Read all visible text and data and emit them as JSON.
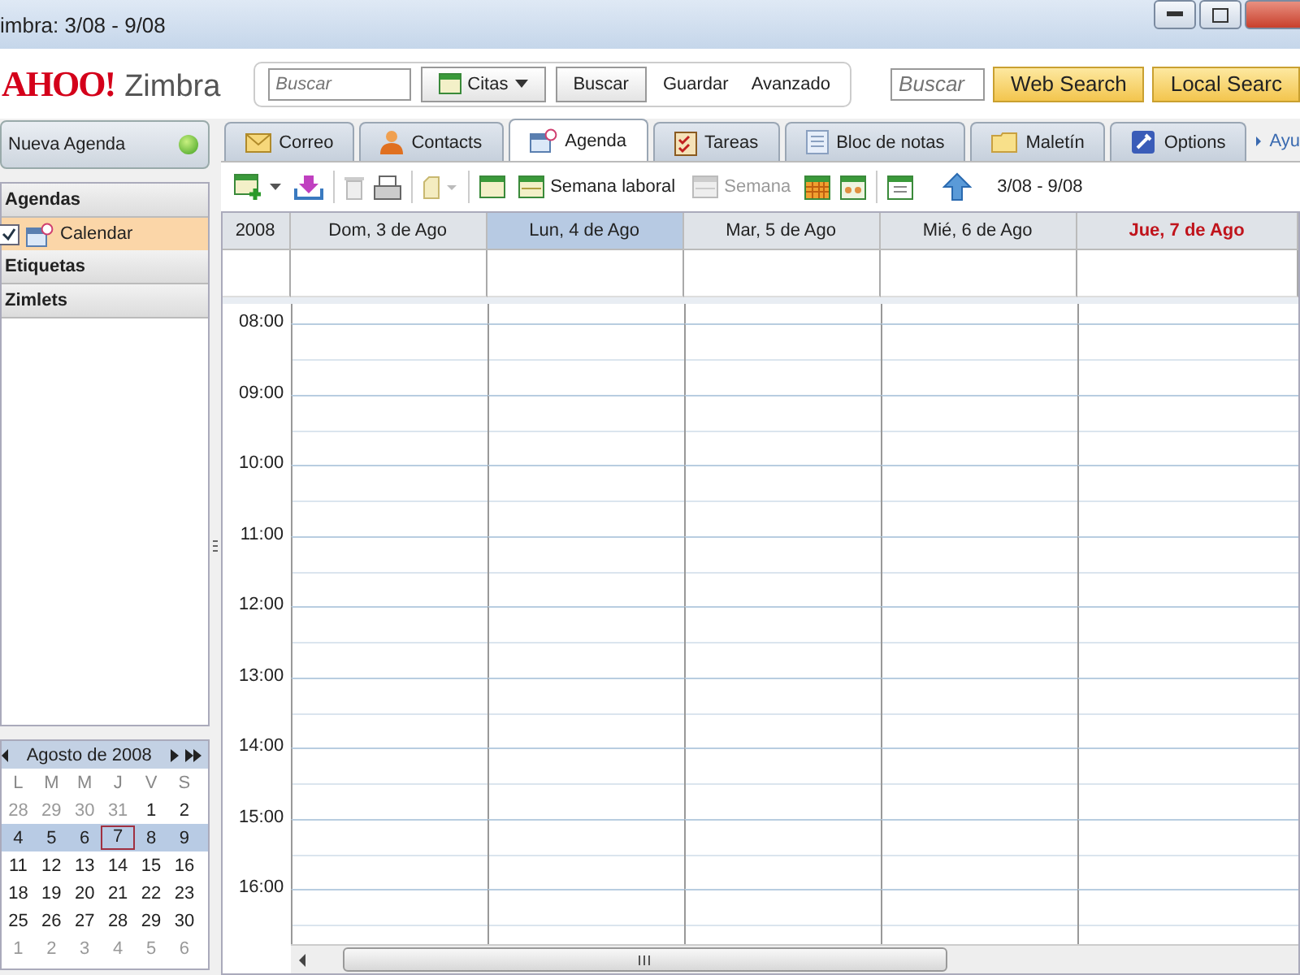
{
  "window": {
    "title": "imbra: 3/08  - 9/08"
  },
  "logo": {
    "brand": "AHOO!",
    "product": "Zimbra"
  },
  "search": {
    "placeholder": "Buscar",
    "type_menu": "Citas",
    "button": "Buscar",
    "links": [
      "Guardar",
      "Avanzado"
    ]
  },
  "web_search": {
    "placeholder": "Buscar",
    "buttons": [
      "Web Search",
      "Local Searc"
    ]
  },
  "new_button": "Nueva Agenda",
  "sections": [
    {
      "label": "Agendas",
      "items": [
        {
          "label": "Calendar",
          "checked": true,
          "selected": true
        }
      ]
    },
    {
      "label": "Etiquetas"
    },
    {
      "label": "Zimlets"
    }
  ],
  "tabs": [
    {
      "label": "Correo",
      "kind": "mail",
      "selected": false
    },
    {
      "label": "Contacts",
      "kind": "contacts",
      "selected": false
    },
    {
      "label": "Agenda",
      "kind": "calendar",
      "selected": true
    },
    {
      "label": "Tareas",
      "kind": "tasks",
      "selected": false
    },
    {
      "label": "Bloc de notas",
      "kind": "notes",
      "selected": false
    },
    {
      "label": "Maletín",
      "kind": "briefcase",
      "selected": false
    },
    {
      "label": "Options",
      "kind": "options",
      "selected": false
    }
  ],
  "help_link": "Ayu",
  "toolbar": {
    "views": [
      {
        "label": "Semana laboral",
        "disabled": false
      },
      {
        "label": "Semana",
        "disabled": true
      }
    ],
    "range": "3/08 - 9/08"
  },
  "calendar": {
    "year": "2008",
    "days": [
      {
        "label": "Dom, 3 de Ago",
        "selected": false,
        "today": false
      },
      {
        "label": "Lun, 4 de Ago",
        "selected": true,
        "today": false
      },
      {
        "label": "Mar, 5 de Ago",
        "selected": false,
        "today": false
      },
      {
        "label": "Mié, 6 de Ago",
        "selected": false,
        "today": false
      },
      {
        "label": "Jue, 7 de Ago",
        "selected": false,
        "today": true
      }
    ],
    "hours": [
      "08:00",
      "09:00",
      "10:00",
      "11:00",
      "12:00",
      "13:00",
      "14:00",
      "15:00",
      "16:00"
    ]
  },
  "mini_calendar": {
    "title": "Agosto de 2008",
    "weekdays": [
      "L",
      "M",
      "M",
      "J",
      "V",
      "S"
    ],
    "weeks": [
      {
        "selected": false,
        "days": [
          {
            "d": "28",
            "other": true,
            "today": false
          },
          {
            "d": "29",
            "other": true,
            "today": false
          },
          {
            "d": "30",
            "other": true,
            "today": false
          },
          {
            "d": "31",
            "other": true,
            "today": false
          },
          {
            "d": "1",
            "other": false,
            "today": false
          },
          {
            "d": "2",
            "other": false,
            "today": false
          }
        ]
      },
      {
        "selected": true,
        "days": [
          {
            "d": "4",
            "other": false,
            "today": false
          },
          {
            "d": "5",
            "other": false,
            "today": false
          },
          {
            "d": "6",
            "other": false,
            "today": false
          },
          {
            "d": "7",
            "other": false,
            "today": true
          },
          {
            "d": "8",
            "other": false,
            "today": false
          },
          {
            "d": "9",
            "other": false,
            "today": false
          }
        ]
      },
      {
        "selected": false,
        "days": [
          {
            "d": "11",
            "other": false,
            "today": false
          },
          {
            "d": "12",
            "other": false,
            "today": false
          },
          {
            "d": "13",
            "other": false,
            "today": false
          },
          {
            "d": "14",
            "other": false,
            "today": false
          },
          {
            "d": "15",
            "other": false,
            "today": false
          },
          {
            "d": "16",
            "other": false,
            "today": false
          }
        ]
      },
      {
        "selected": false,
        "days": [
          {
            "d": "18",
            "other": false,
            "today": false
          },
          {
            "d": "19",
            "other": false,
            "today": false
          },
          {
            "d": "20",
            "other": false,
            "today": false
          },
          {
            "d": "21",
            "other": false,
            "today": false
          },
          {
            "d": "22",
            "other": false,
            "today": false
          },
          {
            "d": "23",
            "other": false,
            "today": false
          }
        ]
      },
      {
        "selected": false,
        "days": [
          {
            "d": "25",
            "other": false,
            "today": false
          },
          {
            "d": "26",
            "other": false,
            "today": false
          },
          {
            "d": "27",
            "other": false,
            "today": false
          },
          {
            "d": "28",
            "other": false,
            "today": false
          },
          {
            "d": "29",
            "other": false,
            "today": false
          },
          {
            "d": "30",
            "other": false,
            "today": false
          }
        ]
      },
      {
        "selected": false,
        "days": [
          {
            "d": "1",
            "other": true,
            "today": false
          },
          {
            "d": "2",
            "other": true,
            "today": false
          },
          {
            "d": "3",
            "other": true,
            "today": false
          },
          {
            "d": "4",
            "other": true,
            "today": false
          },
          {
            "d": "5",
            "other": true,
            "today": false
          },
          {
            "d": "6",
            "other": true,
            "today": false
          }
        ]
      }
    ]
  }
}
